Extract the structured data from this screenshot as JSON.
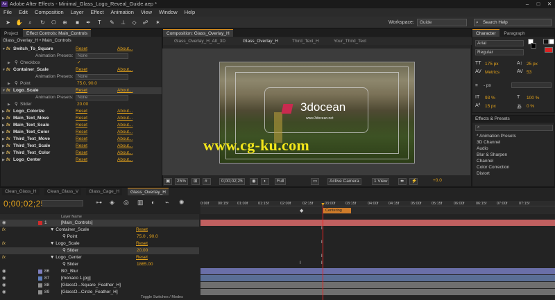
{
  "window": {
    "title": "Adobe After Effects - Minimal_Glass_Logo_Reveal_Guide.aep *",
    "app_icon": "Ae"
  },
  "menu": [
    "File",
    "Edit",
    "Composition",
    "Layer",
    "Effect",
    "Animation",
    "View",
    "Window",
    "Help"
  ],
  "toolbar": {
    "workspace_label": "Workspace:",
    "workspace_value": "Guide",
    "search_placeholder": "Search Help"
  },
  "left_panel": {
    "tabs": [
      "Project",
      "Effect Controls: Main_Controls"
    ],
    "breadcrumb": "Glass_Overlay_H • Main_Controls",
    "effects": [
      {
        "type": "effect",
        "name": "Switch_To_Square",
        "reset": "Reset",
        "about": "About..."
      },
      {
        "type": "preset",
        "label": "Animation Presets:",
        "value": "None"
      },
      {
        "type": "checkbox",
        "label": "Checkbox",
        "value": "✓"
      },
      {
        "type": "effect",
        "name": "Container_Scale",
        "reset": "Reset",
        "about": "About..."
      },
      {
        "type": "preset",
        "label": "Animation Presets:",
        "value": "None"
      },
      {
        "type": "point",
        "label": "Point",
        "value": "75.0, 90.0"
      },
      {
        "type": "effect",
        "name": "Logo_Scale",
        "reset": "Reset",
        "about": "About..."
      },
      {
        "type": "preset",
        "label": "Animation Presets:",
        "value": "None"
      },
      {
        "type": "slider",
        "label": "Slider",
        "value": "20.00"
      },
      {
        "type": "effect",
        "name": "Logo_Colorize",
        "reset": "Reset",
        "about": "About..."
      },
      {
        "type": "effect",
        "name": "Main_Text_Move",
        "reset": "Reset",
        "about": "About..."
      },
      {
        "type": "effect",
        "name": "Main_Text_Scale",
        "reset": "Reset",
        "about": "About..."
      },
      {
        "type": "effect",
        "name": "Main_Text_Color",
        "reset": "Reset",
        "about": "About..."
      },
      {
        "type": "effect",
        "name": "Third_Text_Move",
        "reset": "Reset",
        "about": "About..."
      },
      {
        "type": "effect",
        "name": "Third_Text_Scale",
        "reset": "Reset",
        "about": "About..."
      },
      {
        "type": "effect",
        "name": "Third_Text_Color",
        "reset": "Reset",
        "about": "About..."
      },
      {
        "type": "effect",
        "name": "Logo_Center",
        "reset": "Reset",
        "about": "About..."
      }
    ]
  },
  "composition": {
    "tab": "Composition: Glass_Overlay_H",
    "subtabs": [
      "Glass_Overlay_H_Alt_3D",
      "Glass_Overlay_H",
      "Third_Text_H",
      "Your_Third_Text"
    ],
    "logo_text": "3docean",
    "logo_sub": "www.3docean.net",
    "watermark": "www.cg-ku.com",
    "controls": {
      "zoom": "25%",
      "timecode": "0;00;02;25",
      "resolution": "Full",
      "camera": "Active Camera",
      "view": "1 View",
      "exposure": "+0.0"
    }
  },
  "right_panel": {
    "tabs": [
      "Character",
      "Paragraph"
    ],
    "font": "Arial",
    "style": "Regular",
    "size": "175 px",
    "leading": "25 px",
    "kerning": "Metrics",
    "tracking": "53",
    "stroke_unit": "- px",
    "vscale": "93 %",
    "hscale": "100 %",
    "baseline": "15 px",
    "tsume": "0 %",
    "effects_title": "Effects & Presets",
    "effects_list": [
      "* Animation Presets",
      "3D Channel",
      "Audio",
      "Blur & Sharpen",
      "Channel",
      "Color Correction",
      "Distort"
    ]
  },
  "timeline": {
    "tabs": [
      "Clean_Glass_H",
      "Clean_Glass_V",
      "Glass_Cage_H",
      "Glass_Overlay_H"
    ],
    "timecode": "0;00;02;25",
    "ruler": [
      "0:00f",
      "00:15f",
      "01:00f",
      "01:15f",
      "02:00f",
      "02:15f",
      "03:00f",
      "03:15f",
      "04:00f",
      "04:15f",
      "05:00f",
      "05:15f",
      "06:00f",
      "06:15f",
      "07:00f",
      "07:15f"
    ],
    "marker": "Centering",
    "header": "Layer Name",
    "layers": [
      {
        "num": "1",
        "name": "[Main_Controls]",
        "color": "#d02c2c"
      },
      {
        "kind": "effect",
        "name": "Container_Scale",
        "reset": "Reset"
      },
      {
        "kind": "prop",
        "name": "Point",
        "value": "75.0 , 90.0"
      },
      {
        "kind": "effect",
        "name": "Logo_Scale",
        "reset": "Reset"
      },
      {
        "kind": "prop",
        "name": "Slider",
        "value": "20.00"
      },
      {
        "kind": "effect",
        "name": "Logo_Center",
        "reset": "Reset"
      },
      {
        "kind": "prop",
        "name": "Slider",
        "value": "1865.00"
      },
      {
        "num": "86",
        "name": "BG_Blur",
        "color": "#7f7fbf"
      },
      {
        "num": "87",
        "name": "[monaco 1.jpg]",
        "color": "#5f7fbf"
      },
      {
        "num": "88",
        "name": "[GlassO...Square_Feather_H]",
        "color": "#8f8f8f"
      },
      {
        "num": "89",
        "name": "[GlassO...Circle_Feather_H]",
        "color": "#8f8f8f"
      }
    ],
    "footer": "Toggle Switches / Modes"
  }
}
